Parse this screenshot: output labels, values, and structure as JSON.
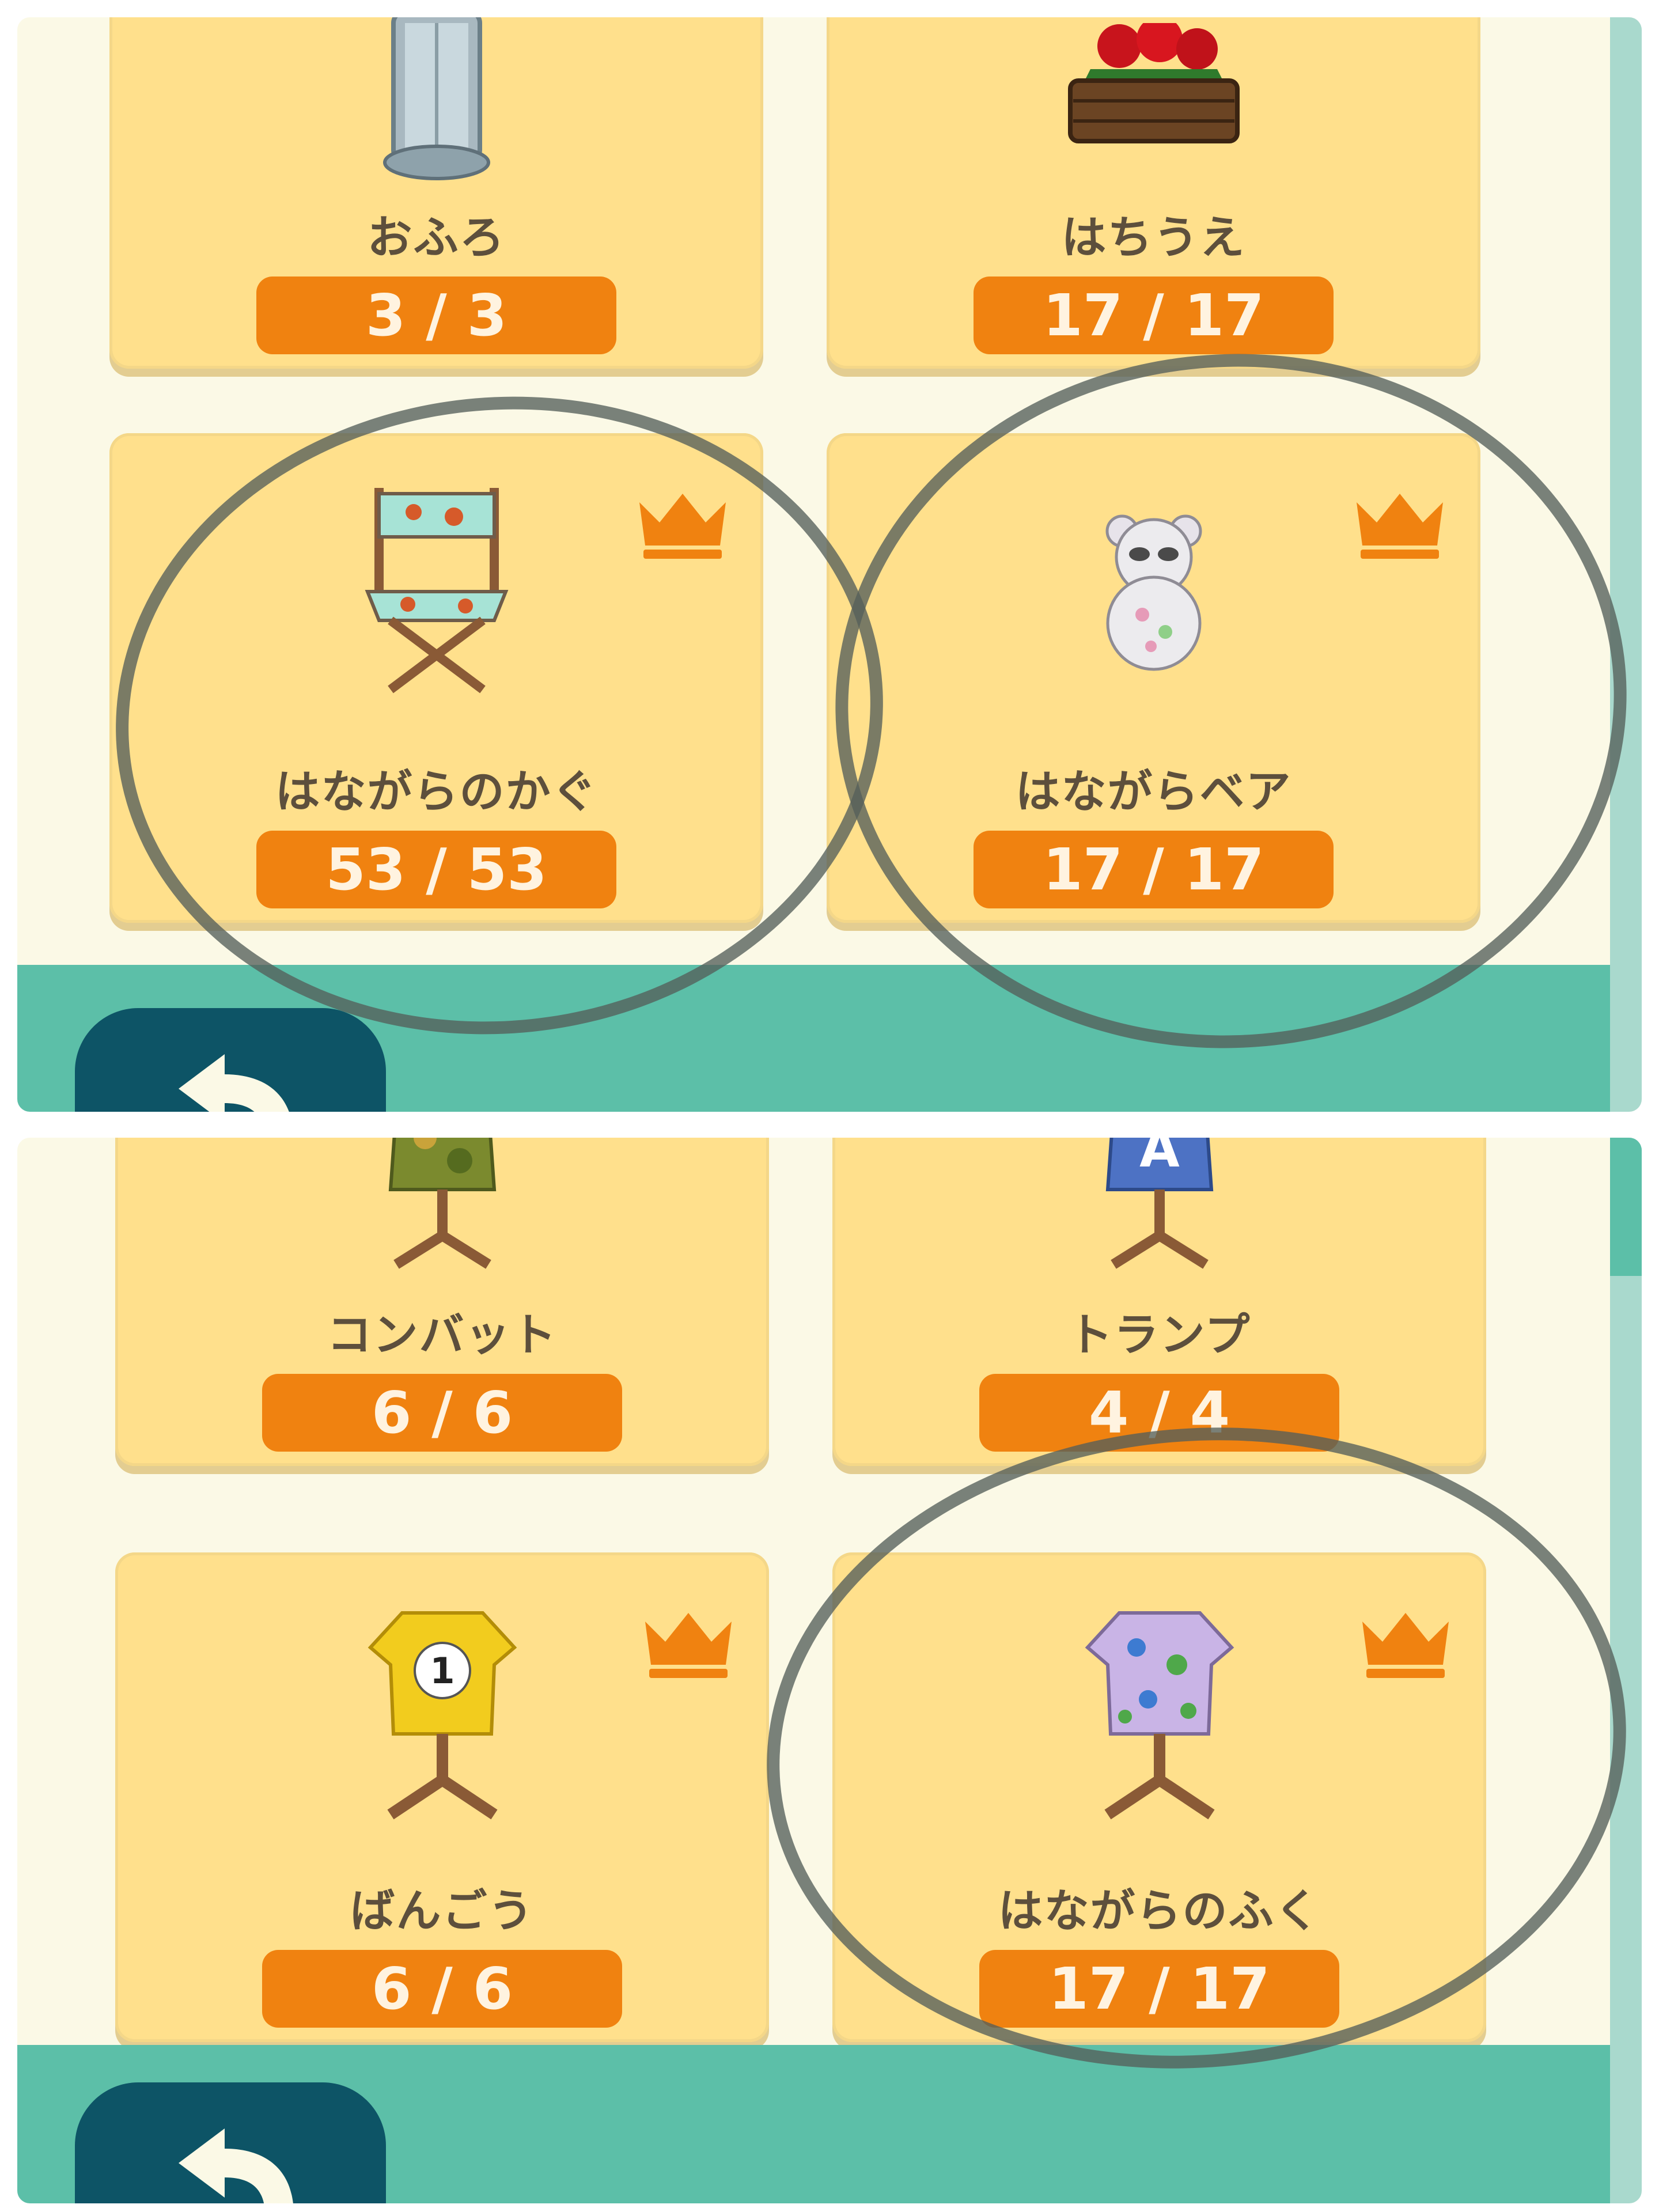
{
  "top_panel": {
    "cards": [
      {
        "name": "おふろ",
        "count": "3 / 3",
        "crown": false,
        "icon": "bath-shower-icon"
      },
      {
        "name": "はちうえ",
        "count": "17 / 17",
        "crown": false,
        "icon": "flower-planter-icon"
      },
      {
        "name": "はながらのかぐ",
        "count": "53 / 53",
        "crown": true,
        "icon": "floral-director-chair-icon"
      },
      {
        "name": "はながらベア",
        "count": "17 / 17",
        "crown": true,
        "icon": "floral-teddy-bear-icon"
      }
    ]
  },
  "bottom_panel": {
    "cards": [
      {
        "name": "コンバット",
        "count": "6 / 6",
        "crown": true,
        "icon": "camo-shirt-mannequin-icon"
      },
      {
        "name": "トランプ",
        "count": "4 / 4",
        "crown": true,
        "icon": "card-shirt-mannequin-icon"
      },
      {
        "name": "ばんごう",
        "count": "6 / 6",
        "crown": true,
        "icon": "number-shirt-mannequin-icon",
        "shirt_number": "1"
      },
      {
        "name": "はながらのふく",
        "count": "17 / 17",
        "crown": true,
        "icon": "floral-shirt-mannequin-icon"
      }
    ],
    "card_b_letter": "A"
  },
  "colors": {
    "card": "#ffe08c",
    "count_badge": "#f08210",
    "crown": "#f08210",
    "bottom_bar": "#5cbfa8",
    "back_button": "#0d5466",
    "annotation": "#555f5a"
  }
}
